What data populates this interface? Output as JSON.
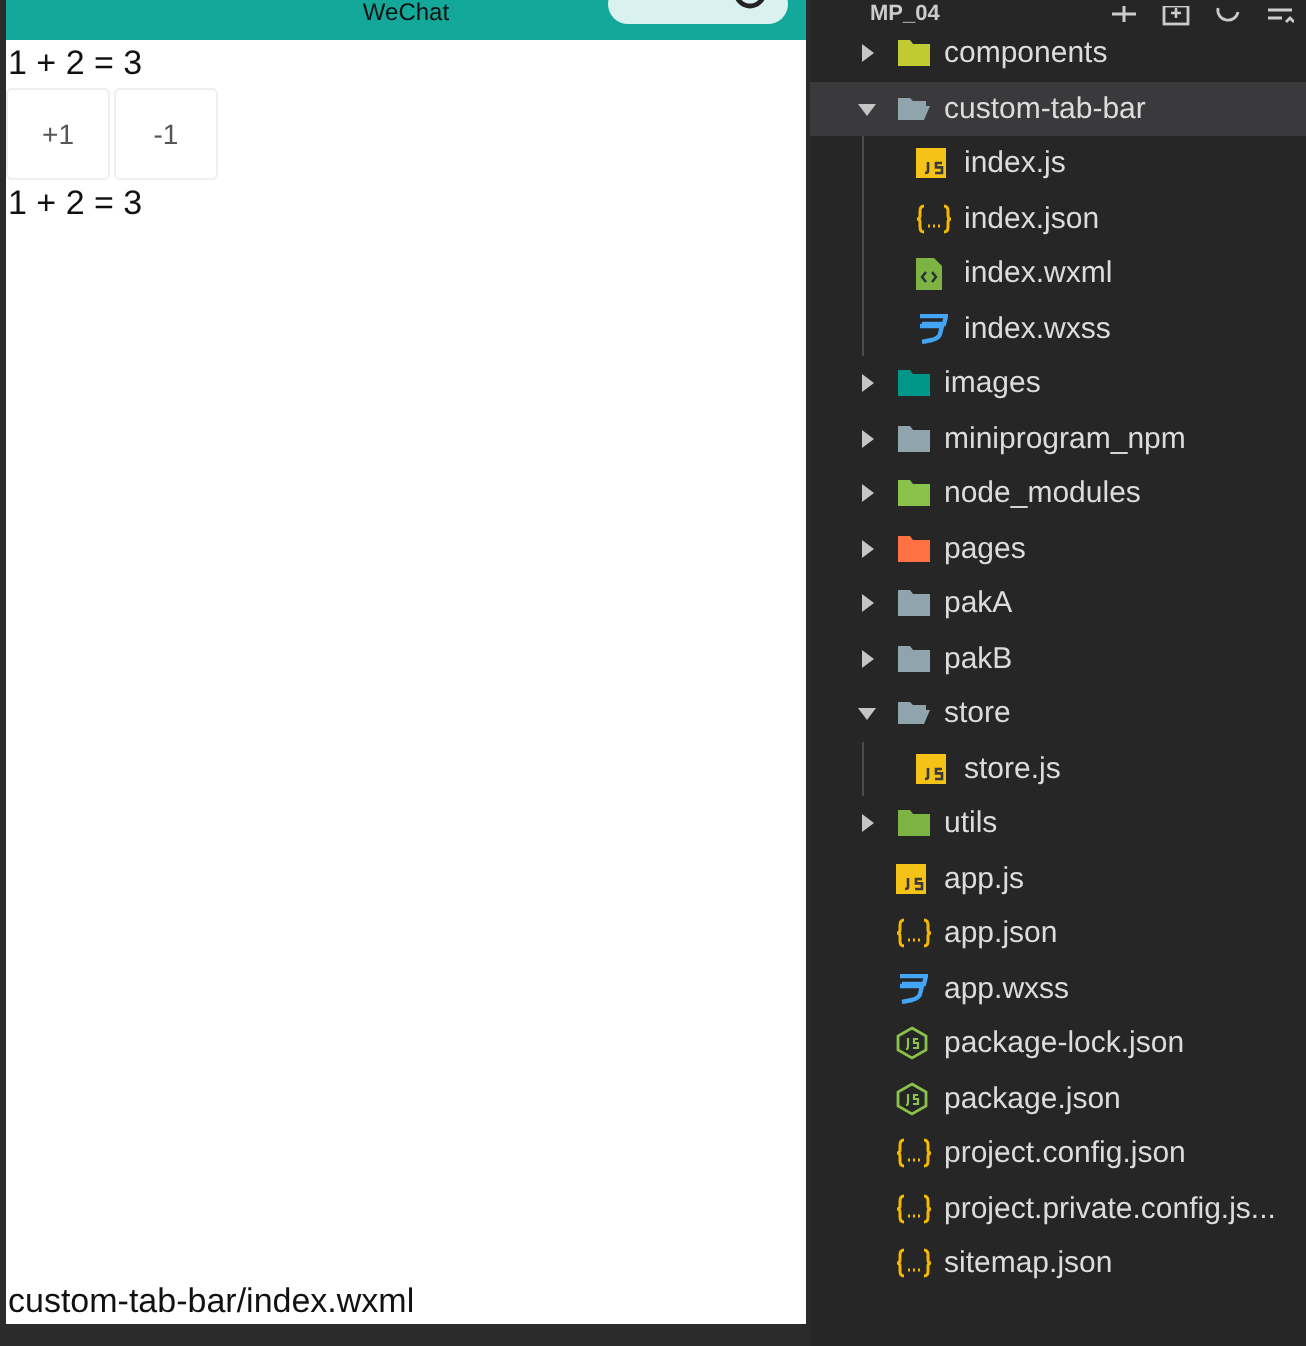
{
  "simulator": {
    "title": "WeChat",
    "lines_top": "1 + 2 = 3",
    "buttons": [
      "+1",
      "-1"
    ],
    "lines_bottom": "1 + 2 = 3",
    "page_path": "custom-tab-bar/index.wxml"
  },
  "explorer": {
    "project": "MP_04",
    "items": [
      {
        "label": "components",
        "kind": "folder",
        "color": "#c0ca33",
        "expanded": false,
        "selected": false
      },
      {
        "label": "custom-tab-bar",
        "kind": "folder",
        "color": "#90a4ae",
        "expanded": true,
        "selected": true,
        "children": [
          {
            "label": "index.js",
            "kind": "js",
            "selected": false
          },
          {
            "label": "index.json",
            "kind": "json",
            "selected": false
          },
          {
            "label": "index.wxml",
            "kind": "wxml",
            "selected": false
          },
          {
            "label": "index.wxss",
            "kind": "wxss",
            "selected": false
          }
        ]
      },
      {
        "label": "images",
        "kind": "folder",
        "color": "#009688",
        "expanded": false,
        "selected": false
      },
      {
        "label": "miniprogram_npm",
        "kind": "folder",
        "color": "#90a4ae",
        "expanded": false,
        "selected": false
      },
      {
        "label": "node_modules",
        "kind": "folder",
        "color": "#8bc34a",
        "expanded": false,
        "selected": false
      },
      {
        "label": "pages",
        "kind": "folder",
        "color": "#ff7043",
        "expanded": false,
        "selected": false
      },
      {
        "label": "pakA",
        "kind": "folder",
        "color": "#90a4ae",
        "expanded": false,
        "selected": false
      },
      {
        "label": "pakB",
        "kind": "folder",
        "color": "#90a4ae",
        "expanded": false,
        "selected": false
      },
      {
        "label": "store",
        "kind": "folder",
        "color": "#90a4ae",
        "expanded": true,
        "selected": false,
        "children": [
          {
            "label": "store.js",
            "kind": "js",
            "selected": false
          }
        ]
      },
      {
        "label": "utils",
        "kind": "folder",
        "color": "#7cb342",
        "expanded": false,
        "selected": false
      },
      {
        "label": "app.js",
        "kind": "js",
        "selected": false
      },
      {
        "label": "app.json",
        "kind": "json",
        "selected": false
      },
      {
        "label": "app.wxss",
        "kind": "wxss",
        "selected": false
      },
      {
        "label": "package-lock.json",
        "kind": "npm",
        "selected": false
      },
      {
        "label": "package.json",
        "kind": "npm",
        "selected": false
      },
      {
        "label": "project.config.json",
        "kind": "json",
        "selected": false
      },
      {
        "label": "project.private.config.js...",
        "kind": "json",
        "selected": false
      },
      {
        "label": "sitemap.json",
        "kind": "json",
        "selected": false
      }
    ]
  }
}
